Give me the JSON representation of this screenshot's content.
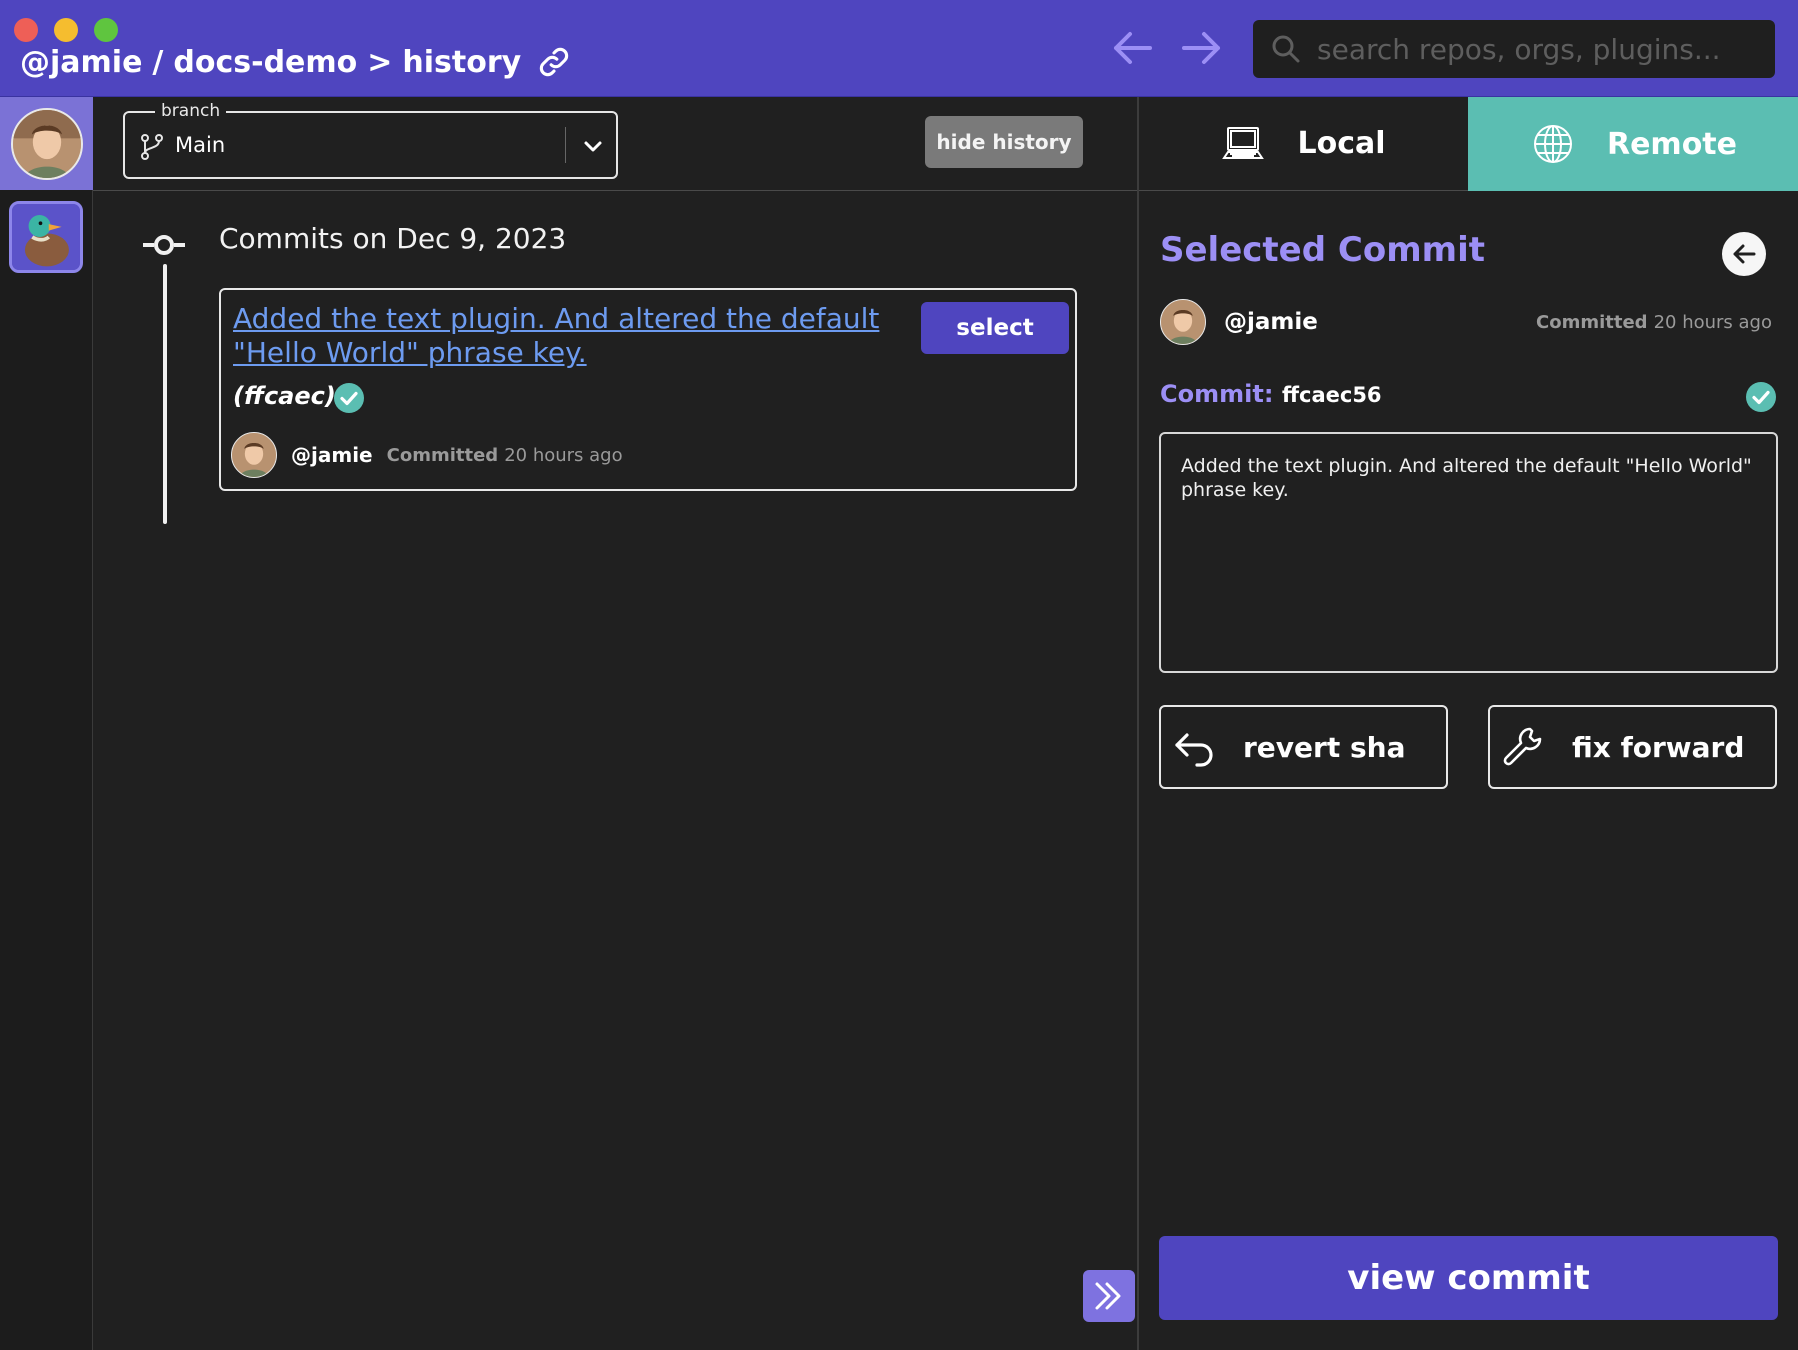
{
  "titlebar": {
    "user": "@jamie",
    "separator": "/",
    "repo": "docs-demo",
    "arrow": ">",
    "page": "history",
    "icons": [
      "link-icon",
      "back-arrow-icon",
      "forward-arrow-icon",
      "search-icon"
    ]
  },
  "search": {
    "placeholder": "search repos, orgs, plugins..."
  },
  "branch": {
    "legend": "branch",
    "value": "Main"
  },
  "toolbar": {
    "hide_history_label": "hide history"
  },
  "history": {
    "group_heading": "Commits on Dec 9, 2023",
    "commits": [
      {
        "title": "Added the text plugin. And altered the default \"Hello World\" phrase key.",
        "sha_short": "(ffcaec)",
        "select_label": "select",
        "author": "@jamie",
        "committed_label": "Committed",
        "time_ago": "20 hours ago"
      }
    ]
  },
  "tabs": {
    "local": "Local",
    "remote": "Remote",
    "active": "remote"
  },
  "selected_commit": {
    "heading": "Selected Commit",
    "author": "@jamie",
    "committed_label": "Committed",
    "time_ago": "20 hours ago",
    "commit_label": "Commit:",
    "sha": "ffcaec56",
    "message": "Added the text plugin. And altered the default \"Hello World\" phrase key.",
    "revert_label": "revert sha",
    "fix_forward_label": "fix forward",
    "view_commit_label": "view commit"
  },
  "colors": {
    "accent": "#4f45bf",
    "accent_light": "#9c8ff5",
    "remote_tab": "#5bbeb2",
    "link": "#6d9bf0",
    "check": "#5bbeb2",
    "background": "#202020"
  }
}
